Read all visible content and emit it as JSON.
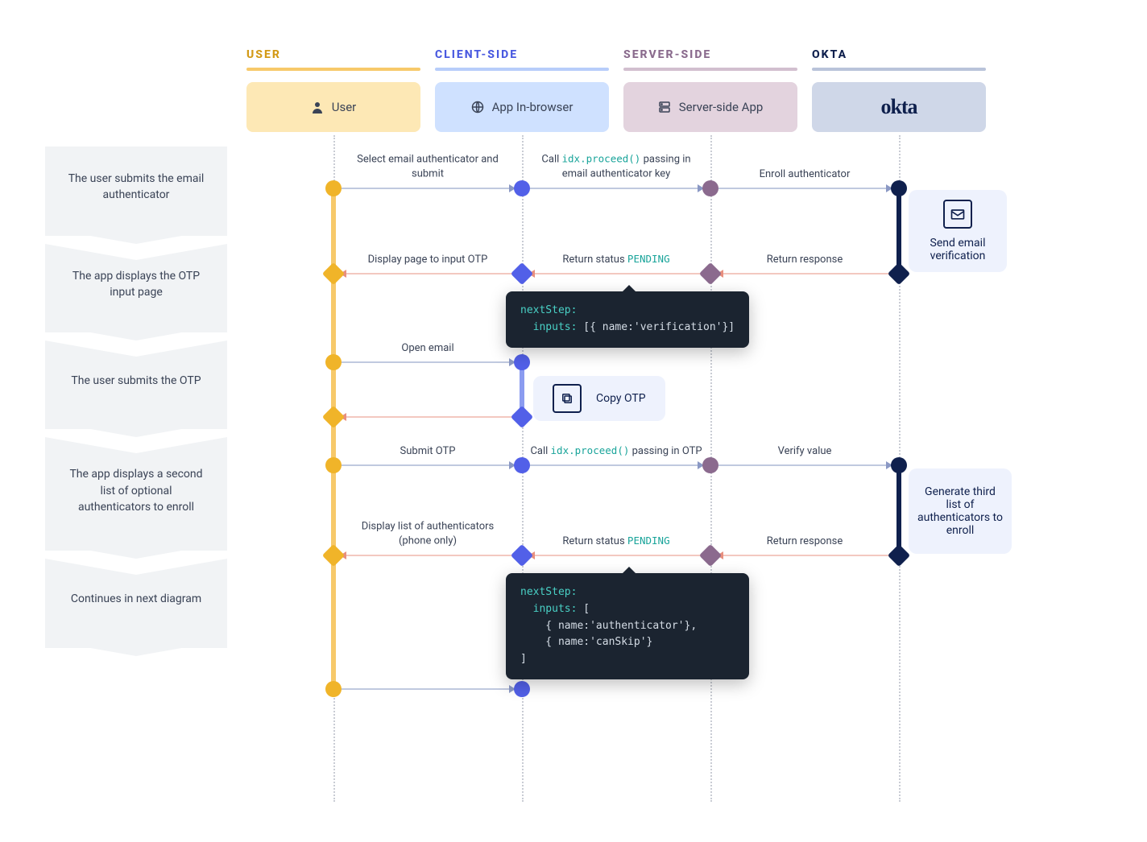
{
  "lanes": {
    "user": {
      "title": "USER",
      "box": "User"
    },
    "client": {
      "title": "CLIENT-SIDE",
      "box": "App In-browser"
    },
    "server": {
      "title": "SERVER-SIDE",
      "box": "Server-side App"
    },
    "okta": {
      "title": "OKTA"
    }
  },
  "steps": {
    "s1": "The user submits the email authenticator",
    "s2": "The app displays the OTP input page",
    "s3": "The user submits the OTP",
    "s4": "The app displays a second list of optional authenticators to enroll",
    "s5": "Continues in next diagram"
  },
  "labels": {
    "l1a": "Select email authenticator and submit",
    "l1b_pre": "Call ",
    "l1b_code": "idx.proceed()",
    "l1b_post": " passing in email authenticator key",
    "l1c": "Enroll authenticator",
    "note1": "Send email verification",
    "l2a": "Return response",
    "l2b_pre": "Return status ",
    "l2b_code": "PENDING",
    "l2c": "Display page to input OTP",
    "code1_a": "nextStep:",
    "code1_b": "  inputs: [{ name:'verification'}]",
    "l3a": "Open email",
    "note2": "Copy OTP",
    "l4a": "Submit OTP",
    "l4b_pre": "Call ",
    "l4b_code": "idx.proceed()",
    "l4b_post": " passing in OTP",
    "l4c": "Verify value",
    "note3": "Generate third list of authenticators to enroll",
    "l5a": "Return response",
    "l5b_pre": "Return status ",
    "l5b_code": "PENDING",
    "l5c": "Display list of authenticators (phone only)",
    "code2_a": "nextStep:",
    "code2_b": "  inputs: [",
    "code2_c": "    { name:'authenticator'},",
    "code2_d": "    { name:'canSkip'}",
    "code2_e": "]"
  }
}
